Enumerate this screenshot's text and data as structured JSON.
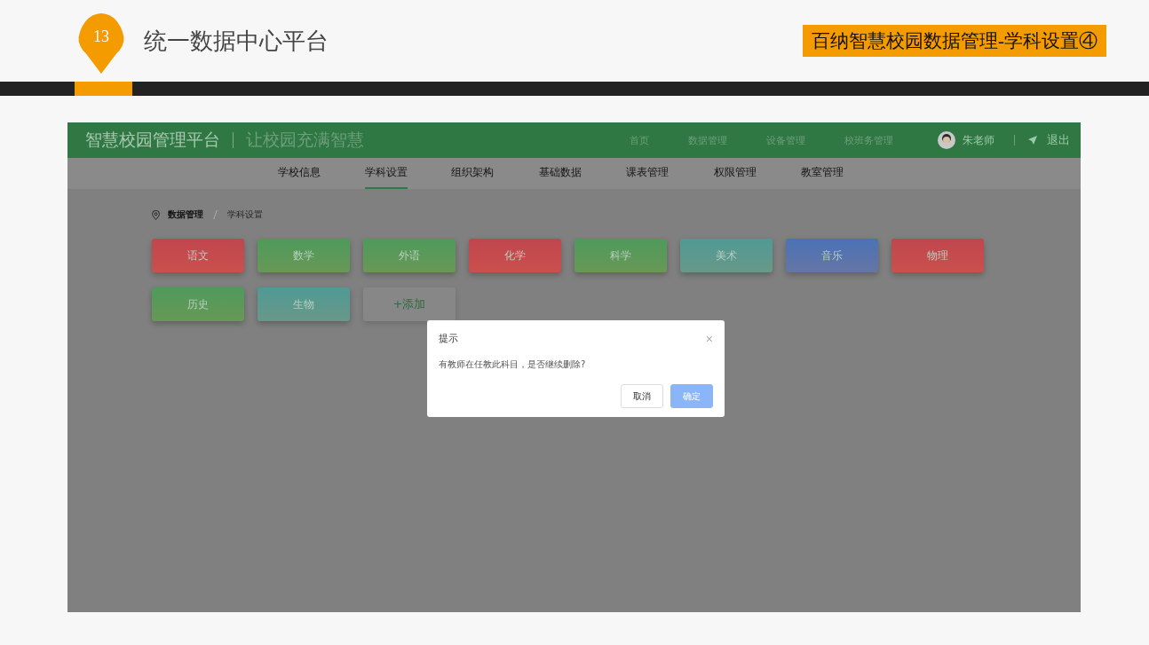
{
  "slide": {
    "number": "13",
    "title": "统一数据中心平台",
    "tag": "百纳智慧校园数据管理-学科设置④"
  },
  "app": {
    "brand": "智慧校园管理平台",
    "slogan": "让校园充满智慧",
    "top_nav": [
      {
        "label": "首页"
      },
      {
        "label": "数据管理"
      },
      {
        "label": "设备管理"
      },
      {
        "label": "校班务管理"
      }
    ],
    "user": "朱老师",
    "logout": "退出",
    "tabs": [
      {
        "label": "学校信息",
        "selected": false
      },
      {
        "label": "学科设置",
        "selected": true
      },
      {
        "label": "组织架构",
        "selected": false
      },
      {
        "label": "基础数据",
        "selected": false
      },
      {
        "label": "课表管理",
        "selected": false
      },
      {
        "label": "权限管理",
        "selected": false
      },
      {
        "label": "教室管理",
        "selected": false
      }
    ],
    "breadcrumb": [
      "数据管理",
      "学科设置"
    ],
    "subjects": [
      {
        "label": "语文",
        "color": "#c0464f"
      },
      {
        "label": "数学",
        "color": "#4e9a5b"
      },
      {
        "label": "外语",
        "color": "#4e9a5b"
      },
      {
        "label": "化学",
        "color": "#c0464f"
      },
      {
        "label": "科学",
        "color": "#4e9a5b"
      },
      {
        "label": "美术",
        "color": "#4f9a95"
      },
      {
        "label": "音乐",
        "color": "#4a72b6"
      },
      {
        "label": "物理",
        "color": "#c0464f"
      },
      {
        "label": "历史",
        "color": "#4e9a5b"
      },
      {
        "label": "生物",
        "color": "#4f9a95"
      }
    ],
    "add_button": "+添加",
    "dialog": {
      "title": "提示",
      "close": "×",
      "message": "有教师在任教此科目，是否继续删除?",
      "buttons": [
        {
          "label": "取消",
          "kind": "secondary"
        },
        {
          "label": "确定",
          "kind": "primary"
        }
      ]
    }
  }
}
